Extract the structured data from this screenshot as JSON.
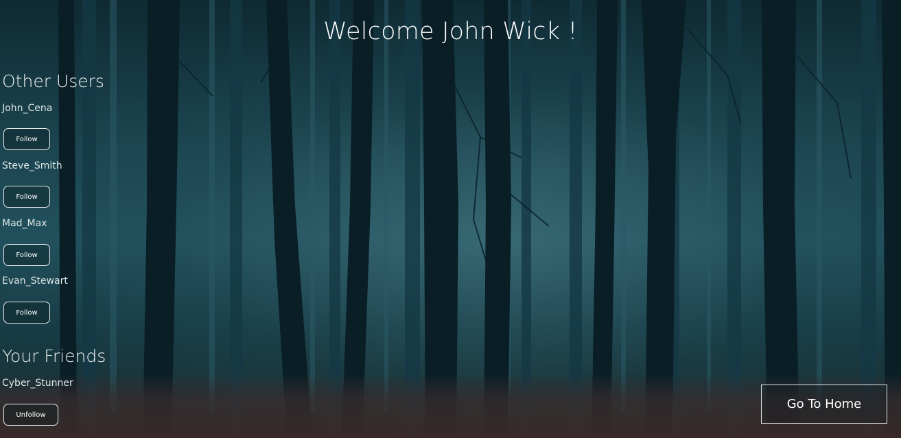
{
  "welcome": "Welcome John Wick !",
  "other_users": {
    "title": "Other Users",
    "users": [
      {
        "name": "John_Cena",
        "action": "Follow"
      },
      {
        "name": "Steve_Smith",
        "action": "Follow"
      },
      {
        "name": "Mad_Max",
        "action": "Follow"
      },
      {
        "name": "Evan_Stewart",
        "action": "Follow"
      }
    ]
  },
  "friends": {
    "title": "Your Friends",
    "users": [
      {
        "name": "Cyber_Stunner",
        "action": "Unfollow"
      }
    ]
  },
  "home_button": "Go To Home",
  "background": {
    "description_icon": "misty-forest-background",
    "fog_color": "#21505c",
    "tree_color": "#0a1e26",
    "ground_color": "#3c2a28"
  }
}
